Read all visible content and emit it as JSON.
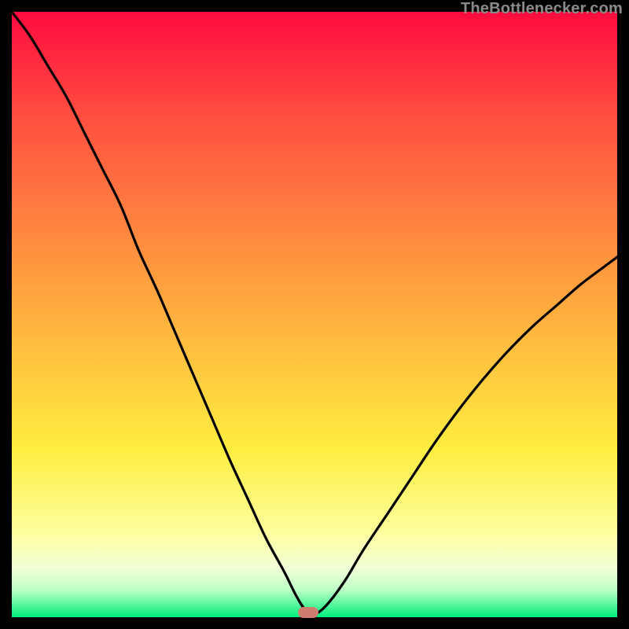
{
  "attribution": "TheBottlenecker.com",
  "colors": {
    "top_red": "#ff0b3f",
    "mid_red": "#ff5140",
    "orange": "#ffa93f",
    "yellow": "#ffed3f",
    "pale_yellow": "#feff9e",
    "pale": "#f0ffd9",
    "pale_green": "#bdffc4",
    "green": "#00ef7c",
    "marker": "#cf7d6f",
    "line": "#000000",
    "frame": "#000000",
    "attribution_text": "#8b8b8b"
  },
  "chart_data": {
    "type": "line",
    "title": "",
    "xlabel": "",
    "ylabel": "",
    "xlim": [
      0,
      100
    ],
    "ylim": [
      0,
      100
    ],
    "x": [
      0,
      3,
      6,
      9,
      12,
      15,
      18,
      21,
      24,
      27,
      30,
      33,
      36,
      39,
      42,
      45,
      47,
      48.5,
      50,
      52,
      55,
      58,
      62,
      66,
      70,
      74,
      78,
      82,
      86,
      90,
      94,
      98,
      100
    ],
    "values": [
      100,
      96,
      91,
      86,
      80,
      74,
      68,
      60.5,
      54,
      47,
      40,
      33,
      26,
      19.5,
      13,
      7.5,
      3.5,
      1.2,
      0.5,
      2,
      6,
      11,
      17,
      23,
      29,
      34.5,
      39.5,
      44,
      48,
      51.5,
      55,
      58,
      59.5
    ],
    "annotations": [
      {
        "type": "marker",
        "x": 49,
        "y": 0.8,
        "shape": "pill"
      }
    ],
    "background_gradient_stops": [
      {
        "pos": 0.0,
        "color": "#ff0b3f"
      },
      {
        "pos": 0.18,
        "color": "#ff5140"
      },
      {
        "pos": 0.48,
        "color": "#ffa93f"
      },
      {
        "pos": 0.72,
        "color": "#ffed3f"
      },
      {
        "pos": 0.86,
        "color": "#feff9e"
      },
      {
        "pos": 0.92,
        "color": "#f0ffd9"
      },
      {
        "pos": 0.955,
        "color": "#bdffc4"
      },
      {
        "pos": 1.0,
        "color": "#00ef7c"
      }
    ]
  }
}
